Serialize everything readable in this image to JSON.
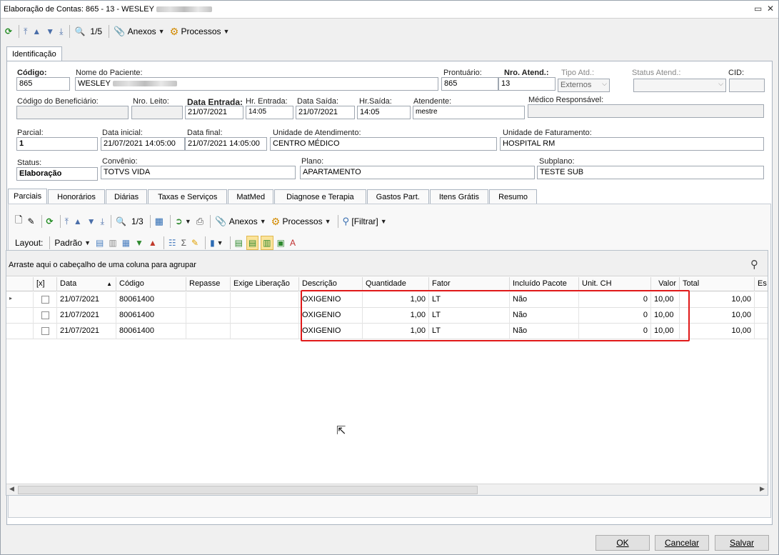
{
  "window": {
    "title": "Elaboração de Contas: 865 - 13 - WESLEY",
    "restore_icon": "restore-icon",
    "close_icon": "close-icon"
  },
  "toolbar_top": {
    "pager": "1/5",
    "anexos": "Anexos",
    "processos": "Processos"
  },
  "main_tab": "Identificação",
  "ident": {
    "codigo_label": "Código:",
    "codigo": "865",
    "nome_label": "Nome do Paciente:",
    "nome": "WESLEY",
    "prontuario_label": "Prontuário:",
    "prontuario": "865",
    "nro_atend_label": "Nro. Atend.:",
    "nro_atend": "13",
    "tipo_atd_label": "Tipo Atd.:",
    "tipo_atd": "Externos",
    "status_atend_label": "Status Atend.:",
    "status_atend": "",
    "cid_label": "CID:",
    "cid": "",
    "cod_benef_label": "Código do Beneficiário:",
    "cod_benef": "",
    "nro_leito_label": "Nro. Leito:",
    "nro_leito": "",
    "data_entrada_label": "Data Entrada:",
    "data_entrada": "21/07/2021",
    "hr_entrada_label": "Hr. Entrada:",
    "hr_entrada": "14:05",
    "data_saida_label": "Data Saída:",
    "data_saida": "21/07/2021",
    "hr_saida_label": "Hr.Saída:",
    "hr_saida": "14:05",
    "atendente_label": "Atendente:",
    "atendente": "mestre",
    "medico_label": "Médico Responsável:",
    "medico": "",
    "parcial_label": "Parcial:",
    "parcial": "1",
    "data_inicial_label": "Data inicial:",
    "data_inicial": "21/07/2021 14:05:00",
    "data_final_label": "Data final:",
    "data_final": "21/07/2021 14:05:00",
    "unid_atend_label": "Unidade de Atendimento:",
    "unid_atend": "CENTRO MÉDICO",
    "unid_fat_label": "Unidade de Faturamento:",
    "unid_fat": "HOSPITAL RM",
    "status_label": "Status:",
    "status": "Elaboração",
    "convenio_label": "Convênio:",
    "convenio": "TOTVS VIDA",
    "plano_label": "Plano:",
    "plano": "APARTAMENTO",
    "subplano_label": "Subplano:",
    "subplano": "TESTE SUB"
  },
  "sub_tabs": [
    "Parciais",
    "Honorários",
    "Diárias",
    "Taxas e Serviços",
    "MatMed",
    "Diagnose e Terapia",
    "Gastos Part.",
    "Itens Grátis",
    "Resumo"
  ],
  "toolbar_inner": {
    "pager": "1/3",
    "anexos": "Anexos",
    "processos": "Processos",
    "filtrar": "[Filtrar]",
    "layout": "Layout:",
    "padrao": "Padrão"
  },
  "grid": {
    "group_hint": "Arraste aqui o cabeçalho de uma coluna para agrupar",
    "columns": [
      "[x]",
      "Data",
      "Código",
      "Repasse",
      "Exige Liberação",
      "Descrição",
      "Quantidade",
      "Fator",
      "Incluído Pacote",
      "Unit. CH",
      "Valor",
      "Total",
      "Es"
    ],
    "rows": [
      [
        "21/07/2021",
        "80061400",
        "",
        "",
        "OXIGENIO",
        "1,00",
        "LT",
        "Não",
        "0",
        "10,00",
        "10,00"
      ],
      [
        "21/07/2021",
        "80061400",
        "",
        "",
        "OXIGENIO",
        "1,00",
        "LT",
        "Não",
        "0",
        "10,00",
        "10,00"
      ],
      [
        "21/07/2021",
        "80061400",
        "",
        "",
        "OXIGENIO",
        "1,00",
        "LT",
        "Não",
        "0",
        "10,00",
        "10,00"
      ]
    ]
  },
  "buttons": {
    "ok": "OK",
    "cancelar": "Cancelar",
    "salvar": "Salvar"
  }
}
